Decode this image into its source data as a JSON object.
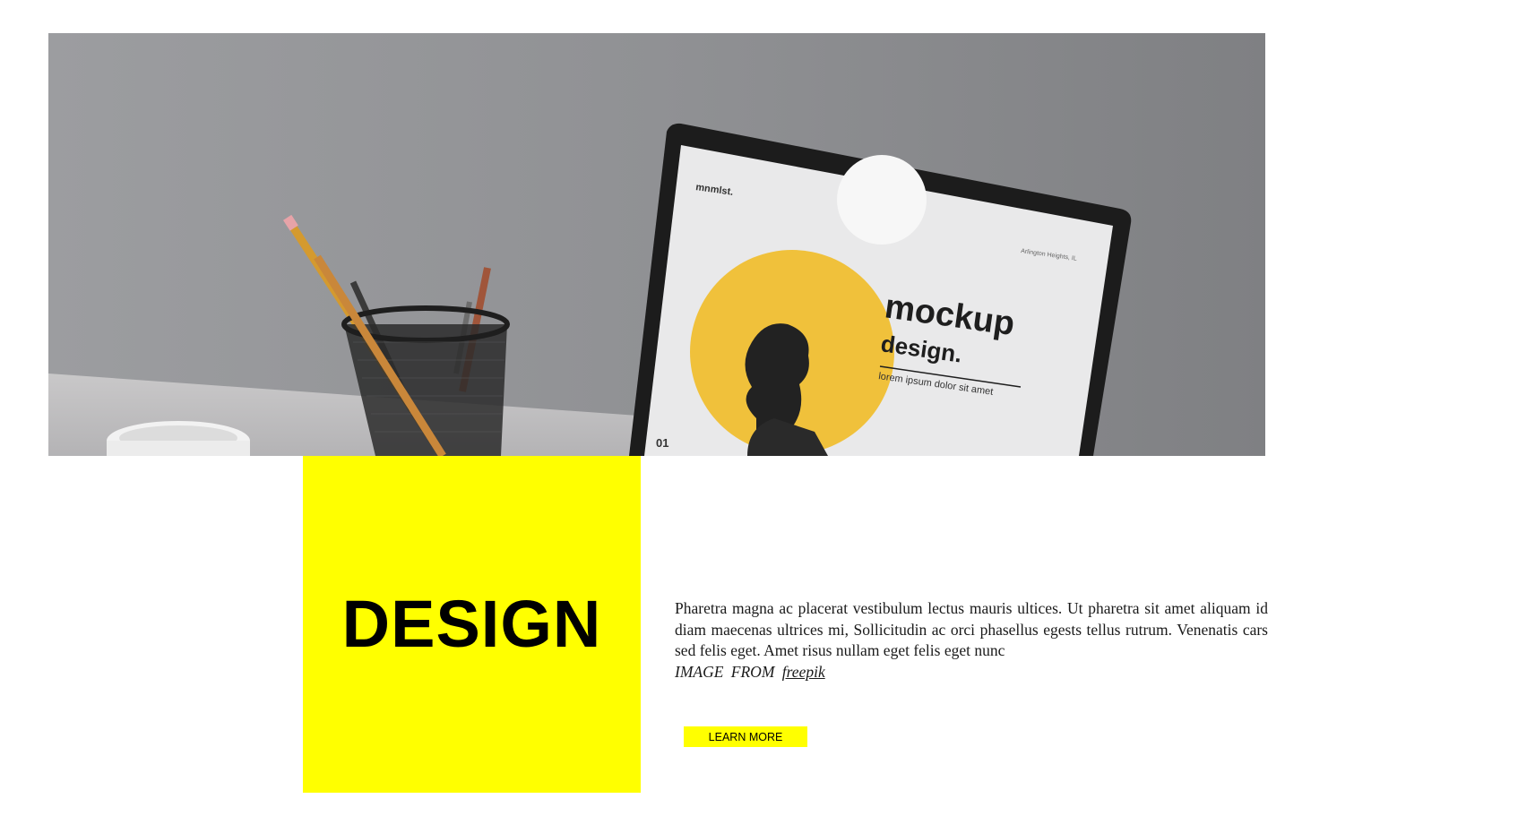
{
  "hero": {
    "screen_brand": "mnmlst.",
    "screen_tagline": "Arlington Heights, IL",
    "screen_title_line1": "mockup",
    "screen_title_line2": "design.",
    "screen_subtitle": "lorem ipsum dolor sit amet",
    "screen_page_number": "01"
  },
  "design_box": {
    "title": "DESIGN",
    "color": "#ffff00"
  },
  "content": {
    "paragraph": "Pharetra magna ac placerat vestibulum lectus mauris ultices. Ut pharetra sit amet aliquam id diam maecenas ultrices mi, Sollicitudin ac orci phasellus egests tellus rutrum. Venenatis cars sed felis eget. Amet risus nullam eget felis eget nunc",
    "credit_prefix": "IMAGE FROM",
    "credit_link": "freepik"
  },
  "button": {
    "label": "LEARN MORE"
  }
}
